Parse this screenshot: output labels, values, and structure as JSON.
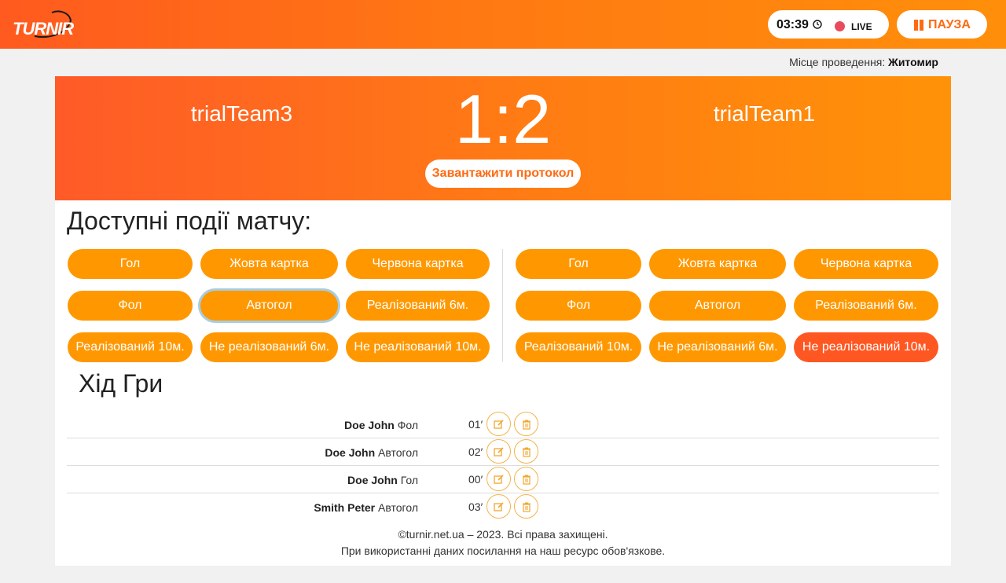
{
  "header": {
    "logo_text": "TURNIR",
    "timer": "03:39",
    "live_label": "LIVE",
    "pause_label": "ПАУЗА",
    "accent_color": "#ff6a12",
    "live_dot_color": "#e94b5e"
  },
  "venue": {
    "label": "Місце проведення:",
    "value": "Житомир"
  },
  "match": {
    "home_team": "trialTeam3",
    "away_team": "trialTeam1",
    "score": "1:2",
    "protocol_button": "Завантажити протокол"
  },
  "events": {
    "title": "Доступні події матчу:",
    "home": [
      "Гол",
      "Жовта картка",
      "Червона картка",
      "Фол",
      "Автогол",
      "Реалізований 6м.",
      "Реалізований 10м.",
      "Не реалізований 6м.",
      "Не реалізований 10м."
    ],
    "away": [
      "Гол",
      "Жовта картка",
      "Червона картка",
      "Фол",
      "Автогол",
      "Реалізований 6м.",
      "Реалізований 10м.",
      "Не реалізований 6м.",
      "Не реалізований 10м."
    ],
    "button_color": "#ff9800",
    "active_color": "#ff5722"
  },
  "game_log": {
    "title": "Хід Гри",
    "rows": [
      {
        "player": "Doe John",
        "event": "Фол",
        "minute": "01′"
      },
      {
        "player": "Doe John",
        "event": "Автогол",
        "minute": "02′"
      },
      {
        "player": "Doe John",
        "event": "Гол",
        "minute": "00′"
      },
      {
        "player": "Smith Peter",
        "event": "Автогол",
        "minute": "03′"
      }
    ]
  },
  "footer": {
    "line1": "©turnir.net.ua – 2023. Всі права захищені.",
    "line2": "При використанні даних посилання на наш ресурс обов'язкове."
  }
}
